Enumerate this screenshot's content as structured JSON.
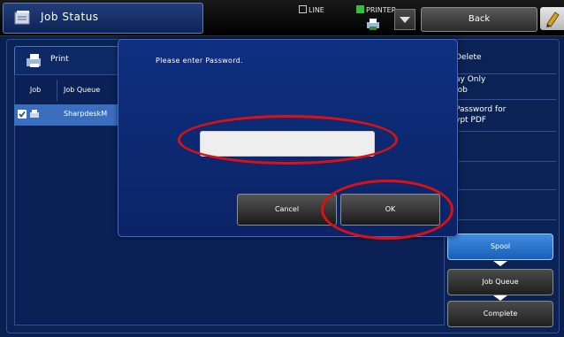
{
  "header": {
    "title": "Job Status",
    "mode_line": "LINE",
    "mode_printer": "PRINTER",
    "back_label": "Back"
  },
  "job_list": {
    "tab_label": "Print",
    "columns": [
      "Job",
      "Job Queue"
    ],
    "rows": [
      {
        "name": "SharpdeskM"
      }
    ]
  },
  "side_actions": {
    "delete": "Delete",
    "display_only_1": "ay Only",
    "display_only_2": "Job",
    "password_1": "Password for",
    "password_2": "ypt PDF"
  },
  "status_flow": {
    "spool": "Spool",
    "job_queue": "Job Queue",
    "complete": "Complete"
  },
  "dialog": {
    "prompt": "Please enter Password.",
    "password_value": "",
    "cancel_label": "Cancel",
    "ok_label": "OK"
  },
  "colors": {
    "background": "#0a1f4d",
    "dialog": "#0f2f80",
    "spool_active": "#3f8de0",
    "highlight_ring": "#e01010",
    "printer_indicator": "#34c038"
  }
}
